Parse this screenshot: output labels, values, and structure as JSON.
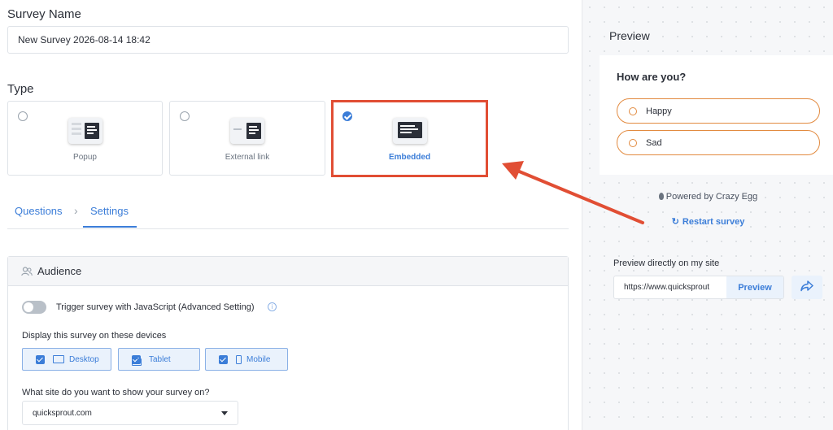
{
  "survey_name": {
    "label": "Survey Name",
    "value": "New Survey 2026-08-14 18:42"
  },
  "type": {
    "label": "Type",
    "options": [
      {
        "label": "Popup",
        "selected": false
      },
      {
        "label": "External link",
        "selected": false
      },
      {
        "label": "Embedded",
        "selected": true
      }
    ]
  },
  "tabs": {
    "questions": "Questions",
    "settings": "Settings",
    "active": "Settings"
  },
  "audience": {
    "title": "Audience",
    "trigger_label": "Trigger survey with JavaScript (Advanced Setting)",
    "trigger_enabled": false,
    "devices_label": "Display this survey on these devices",
    "devices": [
      {
        "label": "Desktop",
        "checked": true
      },
      {
        "label": "Tablet",
        "checked": true
      },
      {
        "label": "Mobile",
        "checked": true
      }
    ],
    "site_label": "What site do you want to show your survey on?",
    "site_value": "quicksprout.com"
  },
  "preview": {
    "title": "Preview",
    "question": "How are you?",
    "options": [
      "Happy",
      "Sad"
    ],
    "powered_by": "Powered by Crazy Egg",
    "restart": "Restart survey",
    "direct_label": "Preview directly on my site",
    "url_value": "https://www.quicksprout",
    "preview_button": "Preview"
  },
  "colors": {
    "accent": "#3b7dd8",
    "highlight": "#e14e34",
    "option_border": "#e28a3f"
  }
}
